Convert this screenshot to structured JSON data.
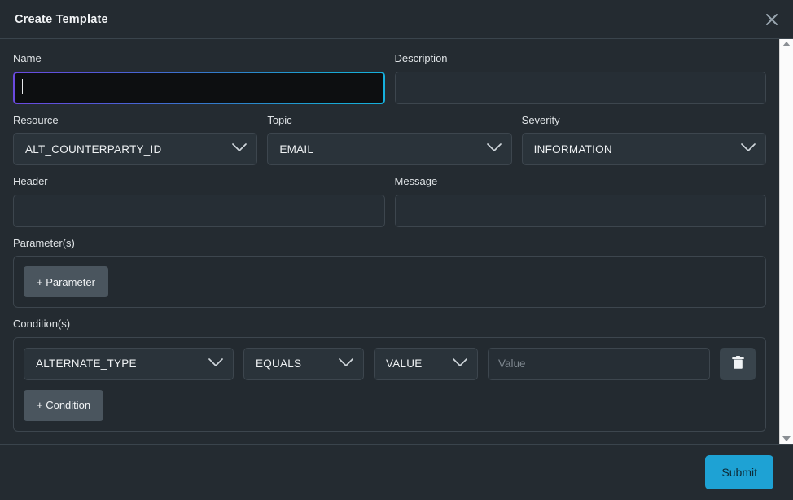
{
  "dialog": {
    "title": "Create Template",
    "close_icon": "close-icon"
  },
  "form": {
    "name": {
      "label": "Name",
      "value": "",
      "placeholder": "",
      "focused": true
    },
    "description": {
      "label": "Description",
      "value": "",
      "placeholder": ""
    },
    "resource": {
      "label": "Resource",
      "value": "ALT_COUNTERPARTY_ID",
      "chevron_icon": "chevron-down-icon"
    },
    "topic": {
      "label": "Topic",
      "value": "EMAIL",
      "chevron_icon": "chevron-down-icon"
    },
    "severity": {
      "label": "Severity",
      "value": "INFORMATION",
      "chevron_icon": "chevron-down-icon"
    },
    "header": {
      "label": "Header",
      "value": "",
      "placeholder": ""
    },
    "message": {
      "label": "Message",
      "value": "",
      "placeholder": ""
    },
    "parameters": {
      "label": "Parameter(s)",
      "add_label": "+ Parameter"
    },
    "conditions": {
      "label": "Condition(s)",
      "add_label": "+ Condition",
      "rows": [
        {
          "attribute": "ALTERNATE_TYPE",
          "operator": "EQUALS",
          "type": "VALUE",
          "value": "",
          "value_placeholder": "Value",
          "delete_icon": "trash-icon"
        }
      ]
    }
  },
  "footer": {
    "submit_label": "Submit"
  },
  "scrollbar": {
    "up_icon": "scroll-up-arrow-icon",
    "down_icon": "scroll-down-arrow-icon"
  },
  "colors": {
    "accent": "#1ea2d4",
    "panel": "#242b31",
    "field": "#2a333a",
    "border": "#3d464e",
    "focus_gradient_start": "#6b4ae0",
    "focus_gradient_end": "#16b0dd"
  }
}
